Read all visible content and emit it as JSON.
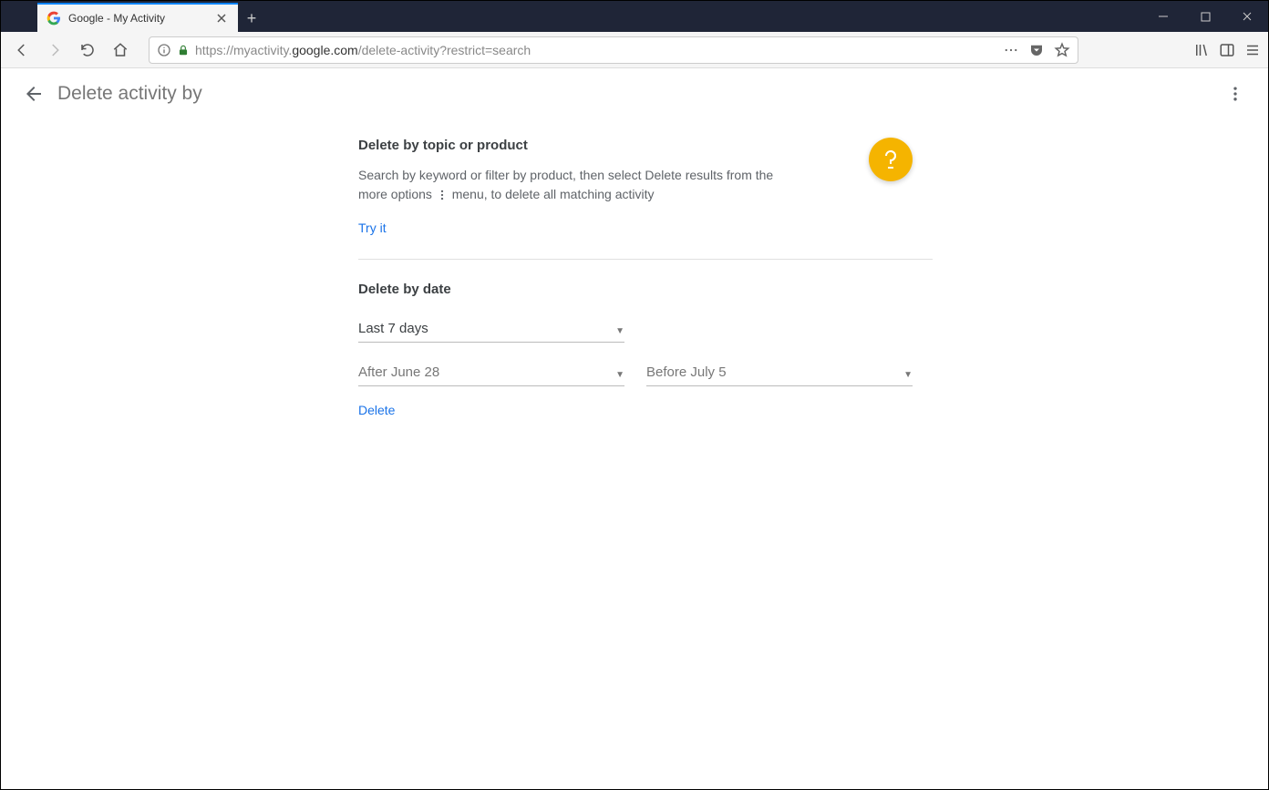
{
  "browser": {
    "tab_title": "Google - My Activity",
    "url_prefix": "https://myactivity.",
    "url_host": "google.com",
    "url_path": "/delete-activity?restrict=search"
  },
  "header": {
    "title": "Delete activity by"
  },
  "topic_section": {
    "heading": "Delete by topic or product",
    "desc_before": "Search by keyword or filter by product, then select Delete results from the more options",
    "desc_after": "menu, to delete all matching activity",
    "try_it": "Try it"
  },
  "date_section": {
    "heading": "Delete by date",
    "range": "Last 7 days",
    "after": "After June 28",
    "before": "Before July 5",
    "delete": "Delete"
  }
}
